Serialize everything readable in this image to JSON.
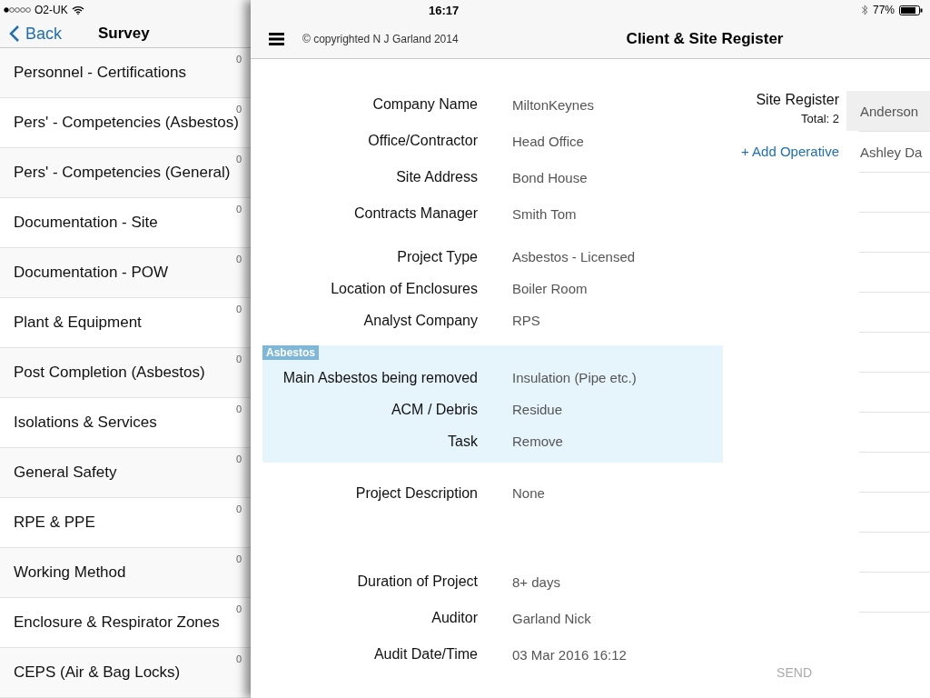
{
  "status_bar": {
    "carrier": "O2-UK",
    "time": "16:17",
    "battery": "77%"
  },
  "sidebar": {
    "back": "Back",
    "title": "Survey",
    "items": [
      {
        "label": "Personnel - Certifications",
        "count": "0"
      },
      {
        "label": "Pers' - Competencies (Asbestos)",
        "count": "0"
      },
      {
        "label": "Pers' - Competencies (General)",
        "count": "0"
      },
      {
        "label": "Documentation - Site",
        "count": "0"
      },
      {
        "label": "Documentation - POW",
        "count": "0"
      },
      {
        "label": "Plant & Equipment",
        "count": "0"
      },
      {
        "label": "Post Completion (Asbestos)",
        "count": "0"
      },
      {
        "label": "Isolations & Services",
        "count": "0"
      },
      {
        "label": "General Safety",
        "count": "0"
      },
      {
        "label": "RPE & PPE",
        "count": "0"
      },
      {
        "label": "Working Method",
        "count": "0"
      },
      {
        "label": "Enclosure & Respirator Zones",
        "count": "0"
      },
      {
        "label": "CEPS (Air & Bag Locks)",
        "count": "0"
      }
    ]
  },
  "header": {
    "copyright": "© copyrighted N J Garland 2014",
    "title": "Client & Site Register"
  },
  "form": {
    "sections": [
      {
        "kind": "fields",
        "rows": [
          {
            "label": "Company Name",
            "value": "MiltonKeynes"
          },
          {
            "label": "Office/Contractor",
            "value": "Head Office"
          },
          {
            "label": "Site Address",
            "value": "Bond House"
          },
          {
            "label": "Contracts Manager",
            "value": "Smith Tom"
          }
        ]
      },
      {
        "kind": "compact",
        "rows": [
          {
            "label": "Project Type",
            "value": "Asbestos - Licensed"
          },
          {
            "label": "Location of Enclosures",
            "value": "Boiler Room"
          },
          {
            "label": "Analyst Company",
            "value": "RPS"
          }
        ]
      },
      {
        "kind": "group",
        "badge": "Asbestos",
        "rows": [
          {
            "label": "Main Asbestos being removed",
            "value": "Insulation (Pipe etc.)"
          },
          {
            "label": "ACM / Debris",
            "value": "Residue"
          },
          {
            "label": "Task",
            "value": "Remove"
          }
        ]
      },
      {
        "kind": "notes",
        "rows": [
          {
            "label": "Project Description",
            "value": "None"
          }
        ]
      },
      {
        "kind": "fields",
        "rows": [
          {
            "label": "Duration of Project",
            "value": "8+ days"
          },
          {
            "label": "Auditor",
            "value": "Garland Nick"
          },
          {
            "label": "Audit Date/Time",
            "value": "03 Mar 2016 16:12"
          }
        ]
      }
    ]
  },
  "register": {
    "title": "Site Register",
    "total": "Total: 2",
    "add": "+ Add Operative",
    "operatives": [
      {
        "name": "Anderson",
        "selected": true
      },
      {
        "name": "Ashley Da",
        "selected": false
      }
    ]
  },
  "send": {
    "label": "SEND",
    "disabled": true
  }
}
